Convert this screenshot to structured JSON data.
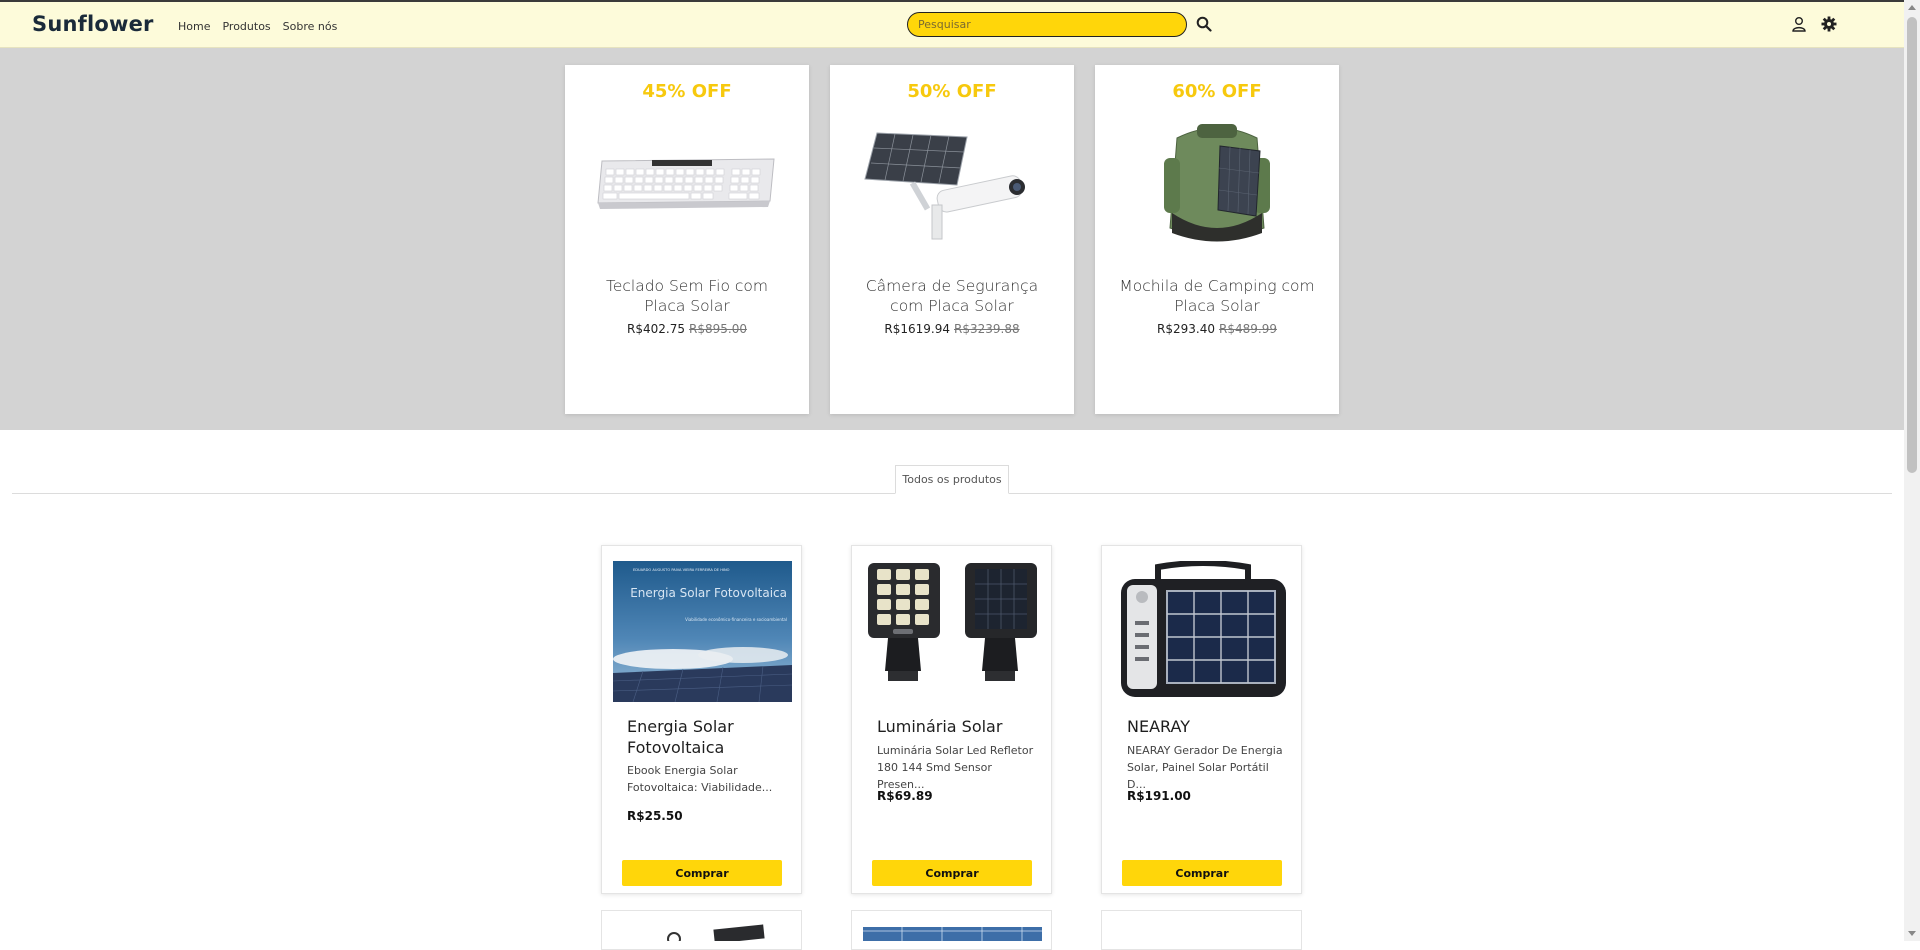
{
  "navbar": {
    "brand": "Sunflower",
    "links": [
      "Home",
      "Produtos",
      "Sobre nós"
    ],
    "search_placeholder": "Pesquisar",
    "icons": [
      "search-icon",
      "user-icon",
      "gear-icon"
    ]
  },
  "promos": [
    {
      "discount": "45% OFF",
      "name": "Teclado Sem Fio com Placa Solar",
      "price": "R$402.75",
      "old_price": "R$895.00"
    },
    {
      "discount": "50% OFF",
      "name": "Câmera de Segurança com Placa Solar",
      "price": "R$1619.94",
      "old_price": "R$3239.88"
    },
    {
      "discount": "60% OFF",
      "name": "Mochila de Camping com Placa Solar",
      "price": "R$293.40",
      "old_price": "R$489.99"
    }
  ],
  "tab_label": "Todos os produtos",
  "products": [
    {
      "title": "Energia Solar Fotovoltaica",
      "description": "Ebook Energia Solar Fotovoltaica: Viabilidade...",
      "price": "R$25.50",
      "button": "Comprar",
      "cover_small": "EDUARDO AUGUSTO PAIVA VIEIRA FERREIRA DE HINO",
      "cover_title": "Energia Solar Fotovoltaica",
      "cover_subtitle": "Viabilidade econômico-financeira e socioambiental"
    },
    {
      "title": "Luminária Solar",
      "description": "Luminária Solar Led Refletor 180 144 Smd Sensor Presen...",
      "price": "R$69.89",
      "button": "Comprar"
    },
    {
      "title": "NEARAY",
      "description": "NEARAY Gerador De Energia Solar, Painel Solar Portátil D...",
      "price": "R$191.00",
      "button": "Comprar"
    }
  ],
  "colors": {
    "accent": "#ffd60a",
    "discount": "#f7c90e",
    "navbar_bg": "#fdfbda",
    "hero_bg": "#d3d3d3"
  }
}
